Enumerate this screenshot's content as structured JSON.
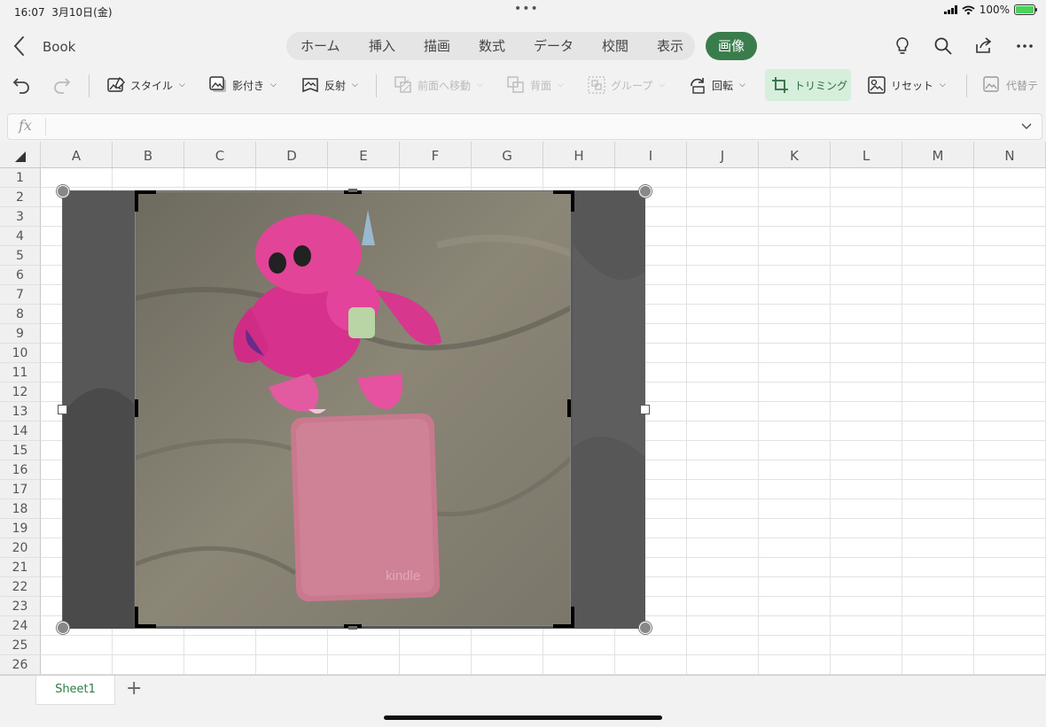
{
  "status": {
    "time": "16:07",
    "date": "3月10日(金)",
    "battery": "100%"
  },
  "title": {
    "doc_name": "Book"
  },
  "ribbon_tabs": [
    {
      "label": "ホーム"
    },
    {
      "label": "挿入"
    },
    {
      "label": "描画"
    },
    {
      "label": "数式"
    },
    {
      "label": "データ"
    },
    {
      "label": "校閲"
    },
    {
      "label": "表示"
    },
    {
      "label": "画像",
      "active": true
    }
  ],
  "toolbar": {
    "style": "スタイル",
    "shadow": "影付き",
    "reflection": "反射",
    "bring_forward": "前面へ移動",
    "send_backward": "背面",
    "group": "グループ",
    "rotate": "回転",
    "crop": "トリミング",
    "reset": "リセット",
    "alt_text": "代替テ"
  },
  "formula_bar": {
    "fx": "fx",
    "value": ""
  },
  "grid": {
    "columns": [
      "A",
      "B",
      "C",
      "D",
      "E",
      "F",
      "G",
      "H",
      "I",
      "J",
      "K",
      "L",
      "M",
      "N"
    ],
    "rows": [
      "1",
      "2",
      "3",
      "4",
      "5",
      "6",
      "7",
      "8",
      "9",
      "10",
      "11",
      "12",
      "13",
      "14",
      "15",
      "16",
      "17",
      "18",
      "19",
      "20",
      "21",
      "22",
      "23",
      "24",
      "25",
      "26"
    ]
  },
  "picture": {
    "watermark": "kindle"
  },
  "sheets": [
    {
      "name": "Sheet1",
      "active": true
    }
  ],
  "colors": {
    "accent": "#3a7d4c",
    "crop_active_bg": "#d6eedc"
  }
}
